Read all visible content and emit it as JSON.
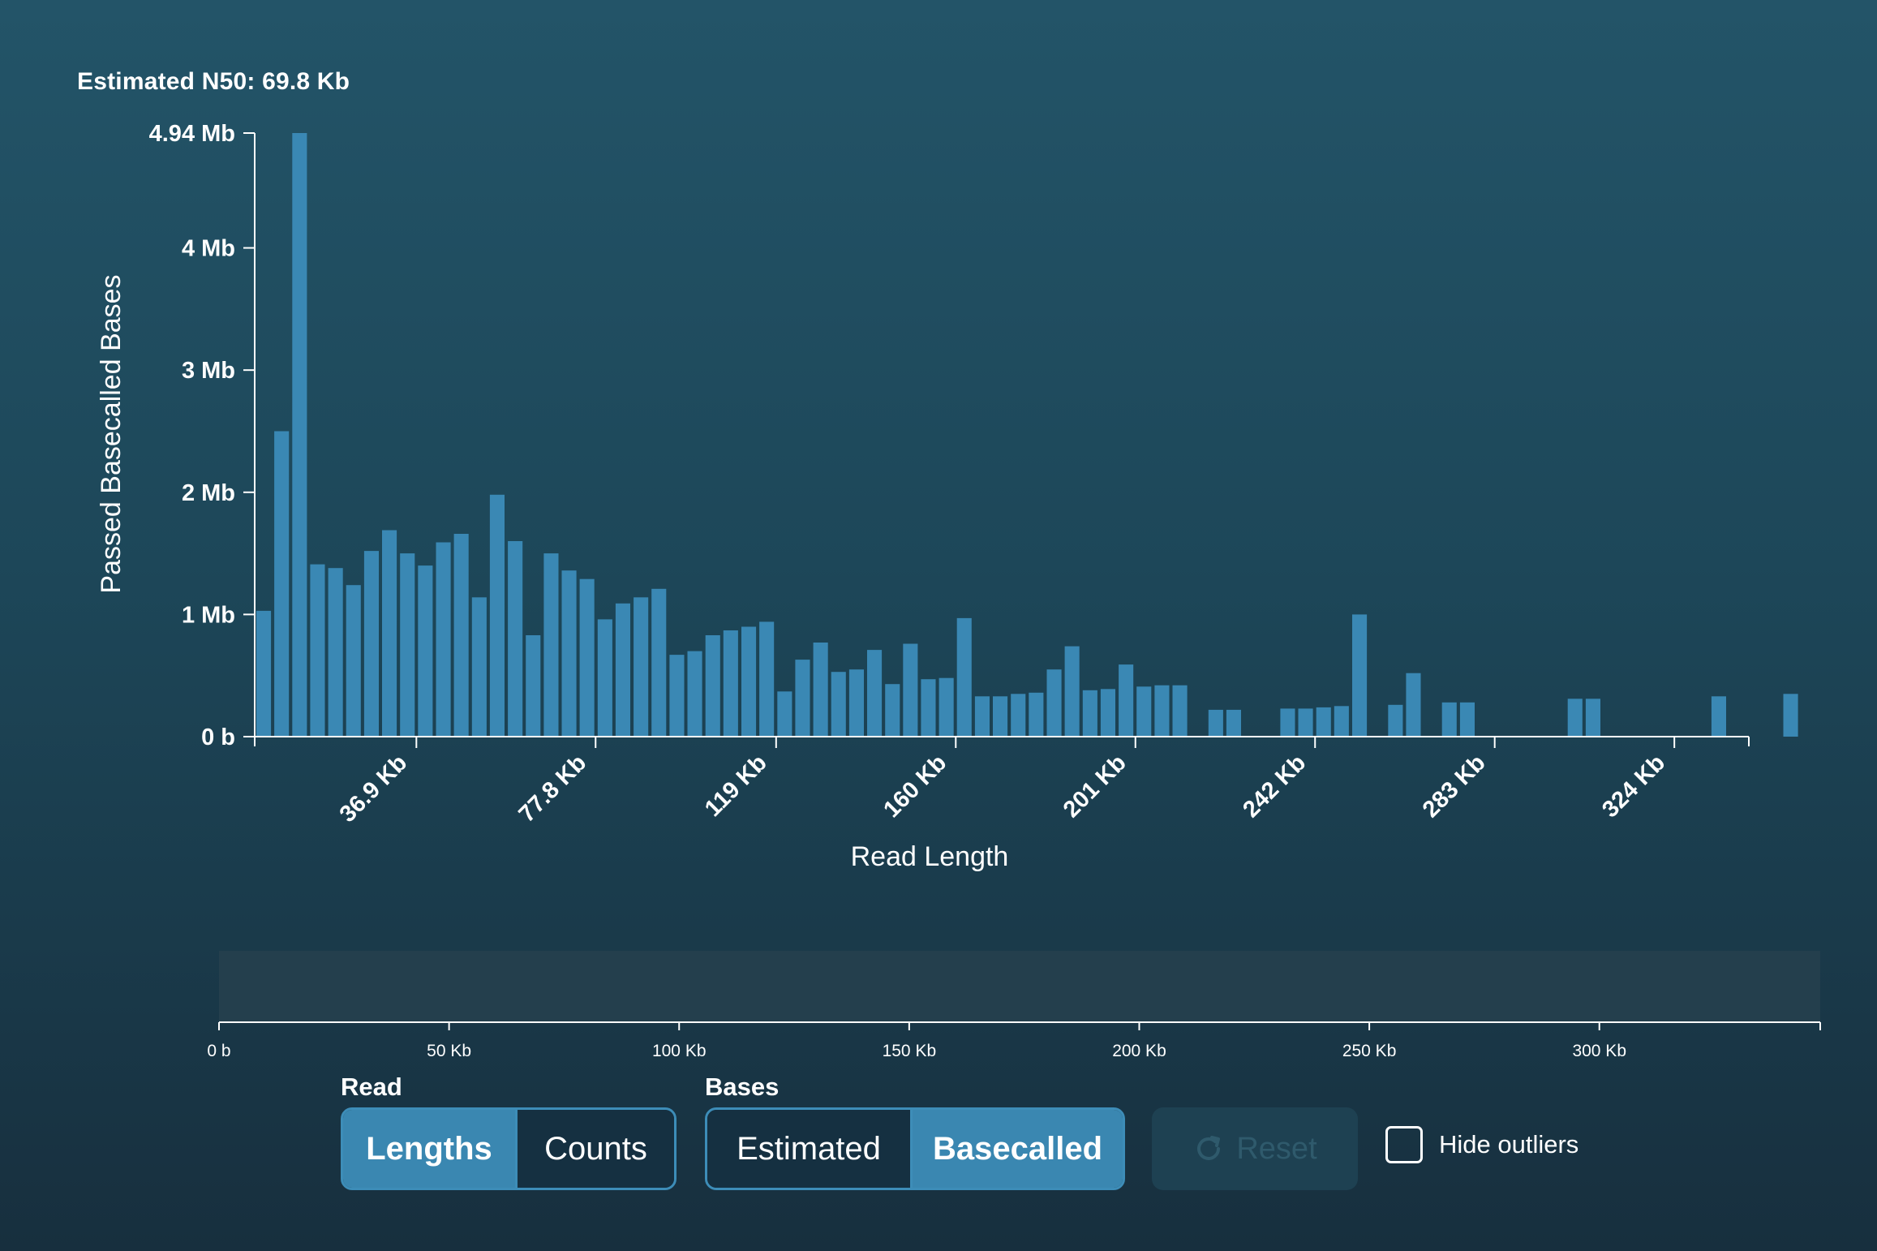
{
  "n50_label": "Estimated N50: 69.8 Kb",
  "colors": {
    "bar": "#3a88b4",
    "axis": "#ffffff",
    "active_button": "#3a87b1",
    "inactive_button": "#153041",
    "brush_track": "#243f4d"
  },
  "chart_data": {
    "type": "bar",
    "xlabel": "Read Length",
    "ylabel": "Passed Basecalled Bases",
    "ylim_mb": [
      0,
      4.94
    ],
    "xlim_kb": [
      0,
      341
    ],
    "bin_width_kb": 4.1,
    "y_ticks": [
      {
        "value": 0,
        "label": "0 b"
      },
      {
        "value": 1,
        "label": "1 Mb"
      },
      {
        "value": 2,
        "label": "2 Mb"
      },
      {
        "value": 3,
        "label": "3 Mb"
      },
      {
        "value": 4,
        "label": "4 Mb"
      },
      {
        "value": 4.94,
        "label": "4.94 Mb"
      }
    ],
    "x_ticks": [
      {
        "value": 36.9,
        "label": "36.9 Kb"
      },
      {
        "value": 77.8,
        "label": "77.8 Kb"
      },
      {
        "value": 119,
        "label": "119 Kb"
      },
      {
        "value": 160,
        "label": "160 Kb"
      },
      {
        "value": 201,
        "label": "201 Kb"
      },
      {
        "value": 242,
        "label": "242 Kb"
      },
      {
        "value": 283,
        "label": "283 Kb"
      },
      {
        "value": 324,
        "label": "324 Kb"
      }
    ],
    "bins_mb": [
      1.03,
      2.5,
      4.94,
      1.41,
      1.38,
      1.24,
      1.52,
      1.69,
      1.5,
      1.4,
      1.59,
      1.66,
      1.14,
      1.98,
      1.6,
      0.83,
      1.5,
      1.36,
      1.29,
      0.96,
      1.09,
      1.14,
      1.21,
      0.67,
      0.7,
      0.83,
      0.87,
      0.9,
      0.94,
      0.37,
      0.63,
      0.77,
      0.53,
      0.55,
      0.71,
      0.43,
      0.76,
      0.47,
      0.48,
      0.97,
      0.33,
      0.33,
      0.35,
      0.36,
      0.55,
      0.74,
      0.38,
      0.39,
      0.59,
      0.41,
      0.42,
      0.42,
      0,
      0.22,
      0.22,
      0,
      0,
      0.23,
      0.23,
      0.24,
      0.25,
      1.0,
      0,
      0.26,
      0.52,
      0,
      0.28,
      0.28,
      0,
      0,
      0,
      0,
      0,
      0.31,
      0.31,
      0,
      0,
      0,
      0,
      0,
      0,
      0.33,
      0,
      0,
      0,
      0.35
    ]
  },
  "brush_axis": {
    "xlim_kb": [
      0,
      348
    ],
    "ticks": [
      {
        "value": 0,
        "label": "0 b"
      },
      {
        "value": 50,
        "label": "50 Kb"
      },
      {
        "value": 100,
        "label": "100 Kb"
      },
      {
        "value": 150,
        "label": "150 Kb"
      },
      {
        "value": 200,
        "label": "200 Kb"
      },
      {
        "value": 250,
        "label": "250 Kb"
      },
      {
        "value": 300,
        "label": "300 Kb"
      }
    ]
  },
  "controls": {
    "read_label": "Read",
    "read_options": {
      "lengths": "Lengths",
      "counts": "Counts"
    },
    "bases_label": "Bases",
    "bases_options": {
      "estimated": "Estimated",
      "basecalled": "Basecalled"
    },
    "reset_label": "Reset",
    "hide_outliers_label": "Hide outliers"
  }
}
